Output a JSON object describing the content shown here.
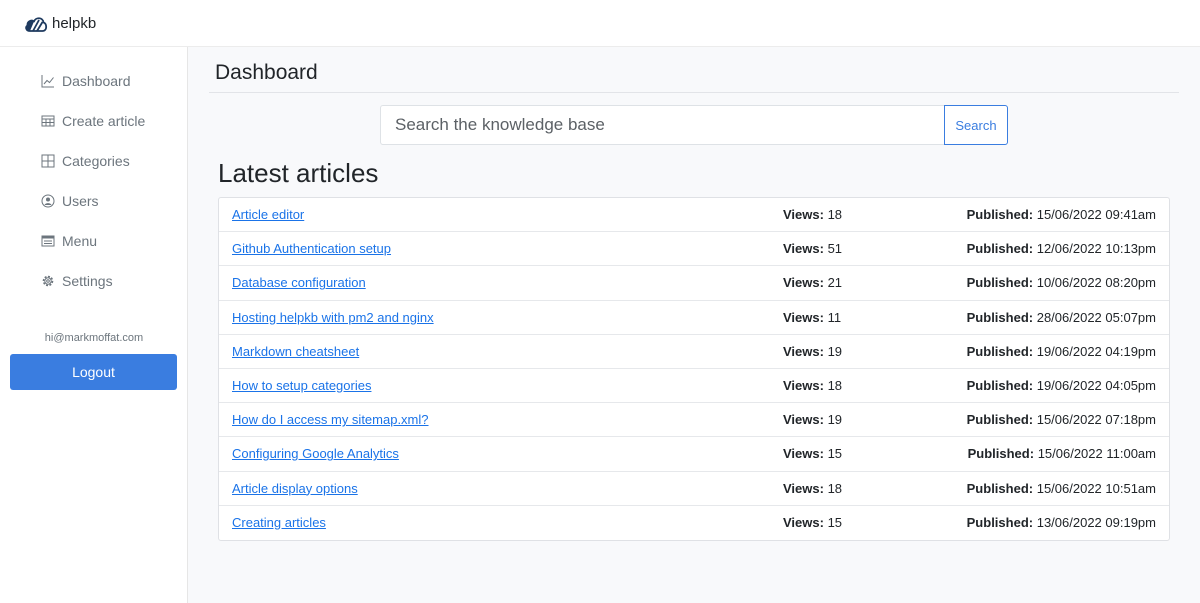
{
  "app": {
    "name": "helpkb"
  },
  "sidebar": {
    "items": [
      {
        "label": "Dashboard",
        "icon": "chart-line-icon"
      },
      {
        "label": "Create article",
        "icon": "table-icon"
      },
      {
        "label": "Categories",
        "icon": "grid-icon"
      },
      {
        "label": "Users",
        "icon": "user-circle-icon"
      },
      {
        "label": "Menu",
        "icon": "menu-list-icon"
      },
      {
        "label": "Settings",
        "icon": "gear-icon"
      }
    ],
    "user_email": "hi@markmoffat.com",
    "logout_label": "Logout"
  },
  "main": {
    "title": "Dashboard",
    "search": {
      "placeholder": "Search the knowledge base",
      "button_label": "Search"
    },
    "section_title": "Latest articles",
    "views_label": "Views:",
    "published_label": "Published:",
    "articles": [
      {
        "title": "Article editor",
        "views": "18",
        "published": "15/06/2022 09:41am"
      },
      {
        "title": "Github Authentication setup",
        "views": "51",
        "published": "12/06/2022 10:13pm"
      },
      {
        "title": "Database configuration",
        "views": "21",
        "published": "10/06/2022 08:20pm"
      },
      {
        "title": "Hosting helpkb with pm2 and nginx",
        "views": "11",
        "published": "28/06/2022 05:07pm"
      },
      {
        "title": "Markdown cheatsheet",
        "views": "19",
        "published": "19/06/2022 04:19pm"
      },
      {
        "title": "How to setup categories",
        "views": "18",
        "published": "19/06/2022 04:05pm"
      },
      {
        "title": "How do I access my sitemap.xml?",
        "views": "19",
        "published": "15/06/2022 07:18pm"
      },
      {
        "title": "Configuring Google Analytics",
        "views": "15",
        "published": "15/06/2022 11:00am"
      },
      {
        "title": "Article display options",
        "views": "18",
        "published": "15/06/2022 10:51am"
      },
      {
        "title": "Creating articles",
        "views": "15",
        "published": "13/06/2022 09:19pm"
      }
    ]
  },
  "colors": {
    "accent": "#3a7de0",
    "link": "#1a73e8",
    "muted": "#6c757d"
  }
}
